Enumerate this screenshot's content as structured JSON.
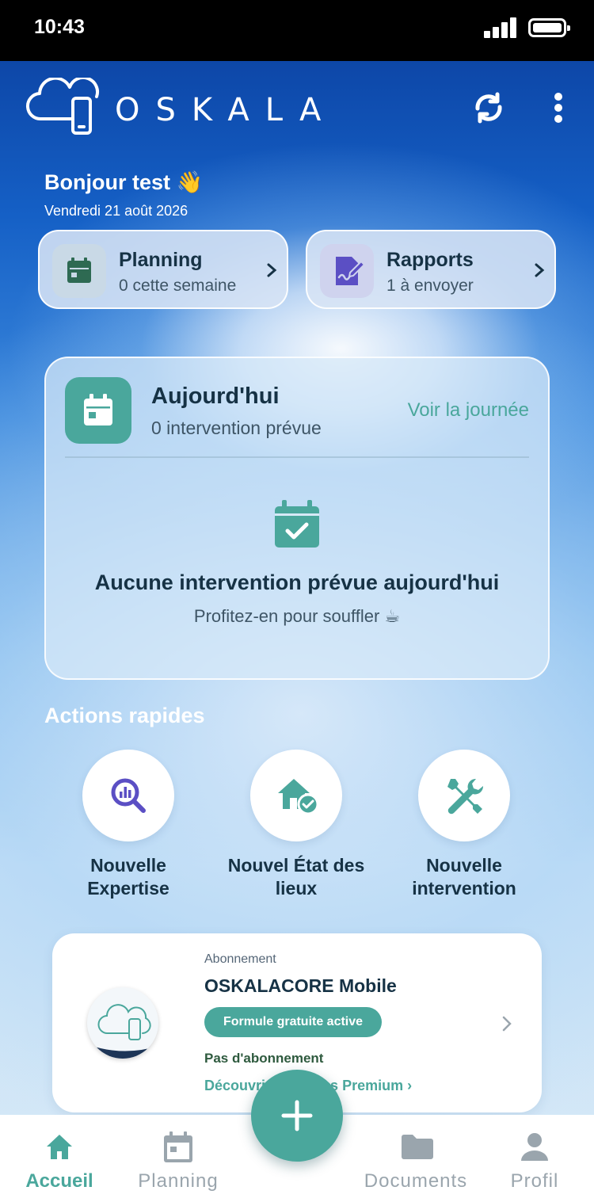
{
  "status_bar": {
    "time": "10:43"
  },
  "header": {
    "brand": "OSKALA",
    "logo_icon": "cloud-phone-logo",
    "sync_icon": "sync-icon",
    "menu_icon": "more-vertical-icon"
  },
  "greeting": {
    "hello": "Bonjour test 👋",
    "date": "Vendredi 21 août 2026"
  },
  "summary": {
    "planning": {
      "title": "Planning",
      "subtitle": "0 cette semaine",
      "icon": "calendar-icon",
      "icon_color": "#2e6a52"
    },
    "rapports": {
      "title": "Rapports",
      "subtitle": "1 à envoyer",
      "icon": "signature-document-icon",
      "icon_color": "#5b4fc4"
    }
  },
  "today": {
    "title": "Aujourd'hui",
    "subtitle": "0 intervention prévue",
    "link": "Voir la journée",
    "empty_title": "Aucune intervention prévue aujourd'hui",
    "empty_subtitle": "Profitez-en pour souffler ☕"
  },
  "quick_actions": {
    "title": "Actions rapides",
    "items": [
      {
        "label_line1": "Nouvelle",
        "label_line2": "Expertise",
        "icon": "magnifier-chart-icon",
        "color": "#5b4fc4"
      },
      {
        "label_line1": "Nouvel État des",
        "label_line2": "lieux",
        "icon": "house-check-icon",
        "color": "#4aa79c"
      },
      {
        "label_line1": "Nouvelle",
        "label_line2": "intervention",
        "icon": "tools-icon",
        "color": "#4aa79c"
      }
    ]
  },
  "subscription": {
    "kicker": "Abonnement",
    "name": "OSKALACORE Mobile",
    "plan": "Formule gratuite active",
    "status": "Pas d'abonnement",
    "link": "Découvrir les offres Premium ›"
  },
  "bottom_nav": {
    "items": [
      {
        "label": "Accueil",
        "icon": "home-icon",
        "active": true
      },
      {
        "label": "Planning",
        "icon": "calendar-icon",
        "active": false
      },
      {
        "label": "Documents",
        "icon": "folder-icon",
        "active": false
      },
      {
        "label": "Profil",
        "icon": "person-icon",
        "active": false
      }
    ],
    "fab_icon": "plus-icon"
  },
  "colors": {
    "accent": "#4aa79c",
    "dark_text": "#163245",
    "sky_top": "#0a3d9c"
  }
}
